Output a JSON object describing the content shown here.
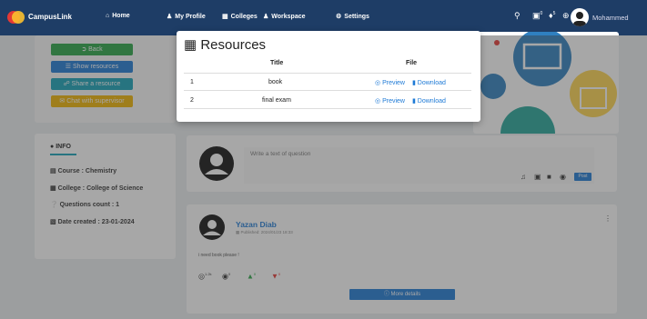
{
  "navbar": {
    "brand": "CampusLink",
    "items": [
      {
        "label": "Home",
        "icon": "home-icon"
      },
      {
        "label": "My Profile",
        "icon": "user-icon"
      },
      {
        "label": "Colleges",
        "icon": "building-icon"
      },
      {
        "label": "Workspace",
        "icon": "people-icon"
      },
      {
        "label": "Settings",
        "icon": "gear-icon"
      }
    ],
    "badges": {
      "notifications": "5",
      "messages": "0"
    },
    "user_name": "Mohammed"
  },
  "left_actions": {
    "back": "Back",
    "show_resources": "Show resources",
    "share_resource": "Share a resource",
    "chat": "Chat with supervisor"
  },
  "info": {
    "title": "INFO",
    "course": "Course : Chemistry",
    "college": "College : College of Science",
    "questions": "Questions count : 1",
    "date": "Date created : 23-01-2024"
  },
  "composer": {
    "placeholder": "Write a text of question",
    "post_label": "Post"
  },
  "post": {
    "author": "Yazan Diab",
    "published": "Published: 2024/01/23 18:33",
    "text": "i need book please !",
    "views": "1.2k",
    "comments": "0",
    "likes": "0",
    "dislikes": "0",
    "more_label": "More details"
  },
  "modal": {
    "title": "Resources",
    "headers": {
      "title": "Title",
      "file": "File"
    },
    "rows": [
      {
        "index": "1",
        "title": "book",
        "preview": "Preview",
        "download": "Download"
      },
      {
        "index": "2",
        "title": "final exam",
        "preview": "Preview",
        "download": "Download"
      }
    ]
  },
  "colors": {
    "navbar": "#1e3d66",
    "green": "#28a745",
    "blue": "#1e7ad6",
    "teal": "#17a2b8",
    "yellow": "#f0b400"
  }
}
